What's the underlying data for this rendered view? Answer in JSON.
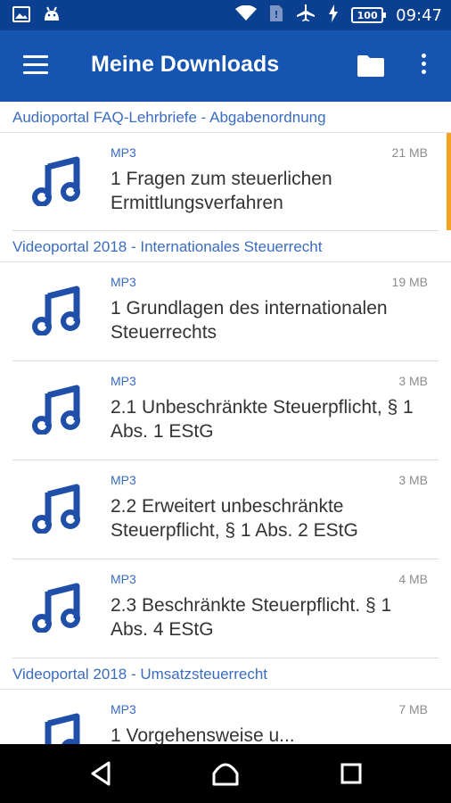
{
  "status_bar": {
    "left_icons": [
      "image-icon",
      "android-icon"
    ],
    "right_icons": [
      "wifi-icon",
      "sim-icon",
      "airplane-icon",
      "charging-icon"
    ],
    "battery": "100",
    "time": "09:47"
  },
  "app_bar": {
    "title": "Meine Downloads",
    "menu_icon": "hamburger-menu-icon",
    "folder_icon": "folder-icon",
    "more_icon": "more-vert-icon"
  },
  "sections": [
    {
      "header": "Audioportal FAQ-Lehrbriefe - Abgabenordnung",
      "items": [
        {
          "type": "MP3",
          "size": "21 MB",
          "title": "1 Fragen zum steuerlichen Ermittlungsverfahren",
          "highlighted": true
        }
      ]
    },
    {
      "header": "Videoportal 2018 - Internationales Steuerrecht",
      "items": [
        {
          "type": "MP3",
          "size": "19 MB",
          "title": "1 Grundlagen des internationalen Steuerrechts"
        },
        {
          "type": "MP3",
          "size": "3 MB",
          "title": "2.1 Unbeschränkte Steuerpflicht, § 1 Abs. 1 EStG"
        },
        {
          "type": "MP3",
          "size": "3 MB",
          "title": "2.2 Erweitert unbeschränkte Steuerpflicht, § 1 Abs. 2 EStG"
        },
        {
          "type": "MP3",
          "size": "4 MB",
          "title": "2.3 Beschränkte Steuerpflicht. § 1 Abs. 4 EStG"
        }
      ]
    },
    {
      "header": "Videoportal 2018 - Umsatzsteuerrecht",
      "items": [
        {
          "type": "MP3",
          "size": "7 MB",
          "title": "1 Vorgehensweise u..."
        }
      ]
    }
  ],
  "colors": {
    "status_bar": "#0b3f8f",
    "app_bar": "#1554b0",
    "accent_text": "#3a6cc0",
    "highlight": "#f4a31c",
    "music_icon": "#1f4fa8"
  },
  "nav_bar": [
    "back-icon",
    "home-icon",
    "recents-icon"
  ]
}
